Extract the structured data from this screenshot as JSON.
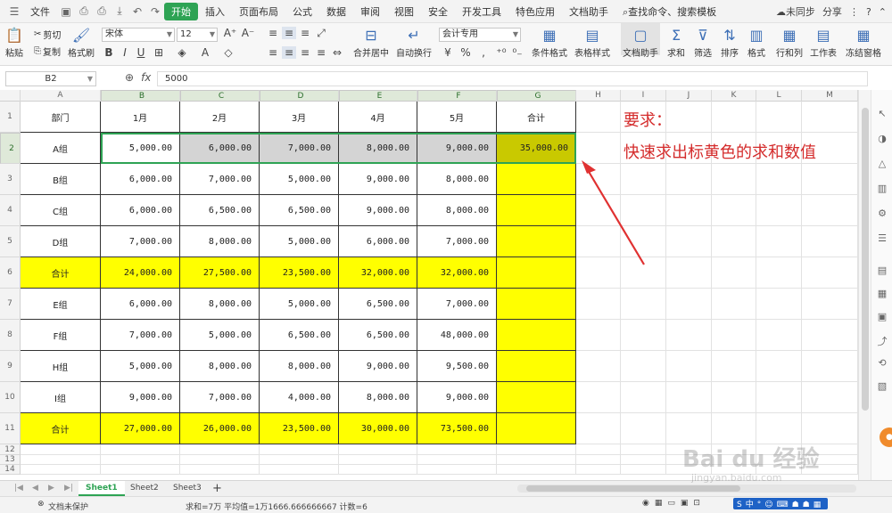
{
  "menu": {
    "app": "文件",
    "items": [
      "开始",
      "插入",
      "页面布局",
      "公式",
      "数据",
      "审阅",
      "视图",
      "安全",
      "开发工具",
      "特色应用",
      "文档助手"
    ],
    "search": "查找命令、搜索模板",
    "sync": "未同步",
    "share": "分享"
  },
  "ribbon": {
    "paste": "粘贴",
    "cut": "剪切",
    "copy": "复制",
    "format_painter": "格式刷",
    "font": "宋体",
    "size": "12",
    "merge": "合并居中",
    "wrap": "自动换行",
    "numfmt": "会计专用",
    "cond": "条件格式",
    "tablefmt": "表格样式",
    "docassist": "文档助手",
    "sum": "求和",
    "filter": "筛选",
    "sort": "排序",
    "format": "格式",
    "rowcol": "行和列",
    "worksheet": "工作表",
    "freeze": "冻结窗格"
  },
  "formula": {
    "cell": "B2",
    "fx": "fx",
    "value": "5000"
  },
  "columns": [
    "A",
    "B",
    "C",
    "D",
    "E",
    "F",
    "G",
    "H",
    "I",
    "J",
    "K",
    "L",
    "M"
  ],
  "rows": [
    "1",
    "2",
    "3",
    "4",
    "5",
    "6",
    "7",
    "8",
    "9",
    "10",
    "11",
    "12",
    "13",
    "14"
  ],
  "table": [
    [
      "部门",
      "1月",
      "2月",
      "3月",
      "4月",
      "5月",
      "合计"
    ],
    [
      "A组",
      "5,000.00",
      "6,000.00",
      "7,000.00",
      "8,000.00",
      "9,000.00",
      "35,000.00"
    ],
    [
      "B组",
      "6,000.00",
      "7,000.00",
      "5,000.00",
      "9,000.00",
      "8,000.00",
      ""
    ],
    [
      "C组",
      "6,000.00",
      "6,500.00",
      "6,500.00",
      "9,000.00",
      "8,000.00",
      ""
    ],
    [
      "D组",
      "7,000.00",
      "8,000.00",
      "5,000.00",
      "6,000.00",
      "7,000.00",
      ""
    ],
    [
      "合计",
      "24,000.00",
      "27,500.00",
      "23,500.00",
      "32,000.00",
      "32,000.00",
      ""
    ],
    [
      "E组",
      "6,000.00",
      "8,000.00",
      "5,000.00",
      "6,500.00",
      "7,000.00",
      ""
    ],
    [
      "F组",
      "7,000.00",
      "5,000.00",
      "6,500.00",
      "6,500.00",
      "48,000.00",
      ""
    ],
    [
      "H组",
      "5,000.00",
      "8,000.00",
      "8,000.00",
      "9,000.00",
      "9,500.00",
      ""
    ],
    [
      "I组",
      "9,000.00",
      "7,000.00",
      "4,000.00",
      "8,000.00",
      "9,000.00",
      ""
    ],
    [
      "合计",
      "27,000.00",
      "26,000.00",
      "23,500.00",
      "30,000.00",
      "73,500.00",
      ""
    ]
  ],
  "annotation": {
    "line1": "要求：",
    "line2": "快速求出标黄色的求和数值"
  },
  "sheets": [
    "Sheet1",
    "Sheet2",
    "Sheet3"
  ],
  "status": {
    "protect": "文档未保护",
    "summary": "求和=7万  平均值=1万1666.666666667  计数=6"
  },
  "watermark": {
    "brand": "Bai du 经验",
    "url": "jingyan.baidu.com"
  },
  "colors": {
    "yellow": "#ffff00",
    "green": "#2ea354",
    "selgray": "#d4d4d4",
    "red": "#d42b2b"
  }
}
